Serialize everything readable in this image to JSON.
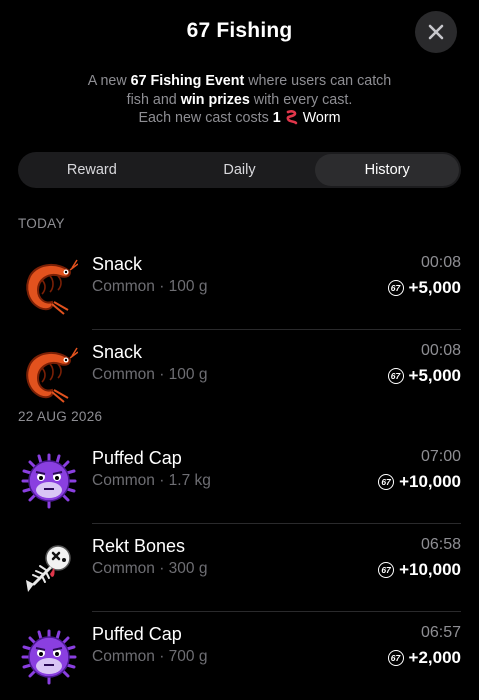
{
  "header": {
    "title": "67 Fishing"
  },
  "description": {
    "line1_pre": "A new ",
    "line1_bold": "67 Fishing Event",
    "line1_post": " where users can catch",
    "line2_pre": "fish and ",
    "line2_bold": "win prizes",
    "line2_post": " with every cast.",
    "line3_pre": "Each new cast costs ",
    "line3_bold": "1",
    "line3_post": "Worm"
  },
  "tabs": [
    {
      "label": "Reward"
    },
    {
      "label": "Daily"
    },
    {
      "label": "History"
    }
  ],
  "sections": {
    "today": "TODAY",
    "past": "22 AUG 2026"
  },
  "coin_symbol": "67",
  "entries": [
    {
      "name": "Snack",
      "rarity": "Common",
      "weight": "100 g",
      "time": "00:08",
      "reward": "+5,000",
      "icon": "shrimp-icon"
    },
    {
      "name": "Snack",
      "rarity": "Common",
      "weight": "100 g",
      "time": "00:08",
      "reward": "+5,000",
      "icon": "shrimp-icon"
    },
    {
      "name": "Puffed Cap",
      "rarity": "Common",
      "weight": "1.7 kg",
      "time": "07:00",
      "reward": "+10,000",
      "icon": "pufferfish-icon"
    },
    {
      "name": "Rekt Bones",
      "rarity": "Common",
      "weight": "300 g",
      "time": "06:58",
      "reward": "+10,000",
      "icon": "fish-bones-icon"
    },
    {
      "name": "Puffed Cap",
      "rarity": "Common",
      "weight": "700 g",
      "time": "06:57",
      "reward": "+2,000",
      "icon": "pufferfish-icon"
    }
  ],
  "colors": {
    "background": "#000000",
    "muted": "#8e8e93",
    "tab_active": "#2c2c2e",
    "shrimp": "#e2521e",
    "puffer": "#8a3fe0"
  }
}
